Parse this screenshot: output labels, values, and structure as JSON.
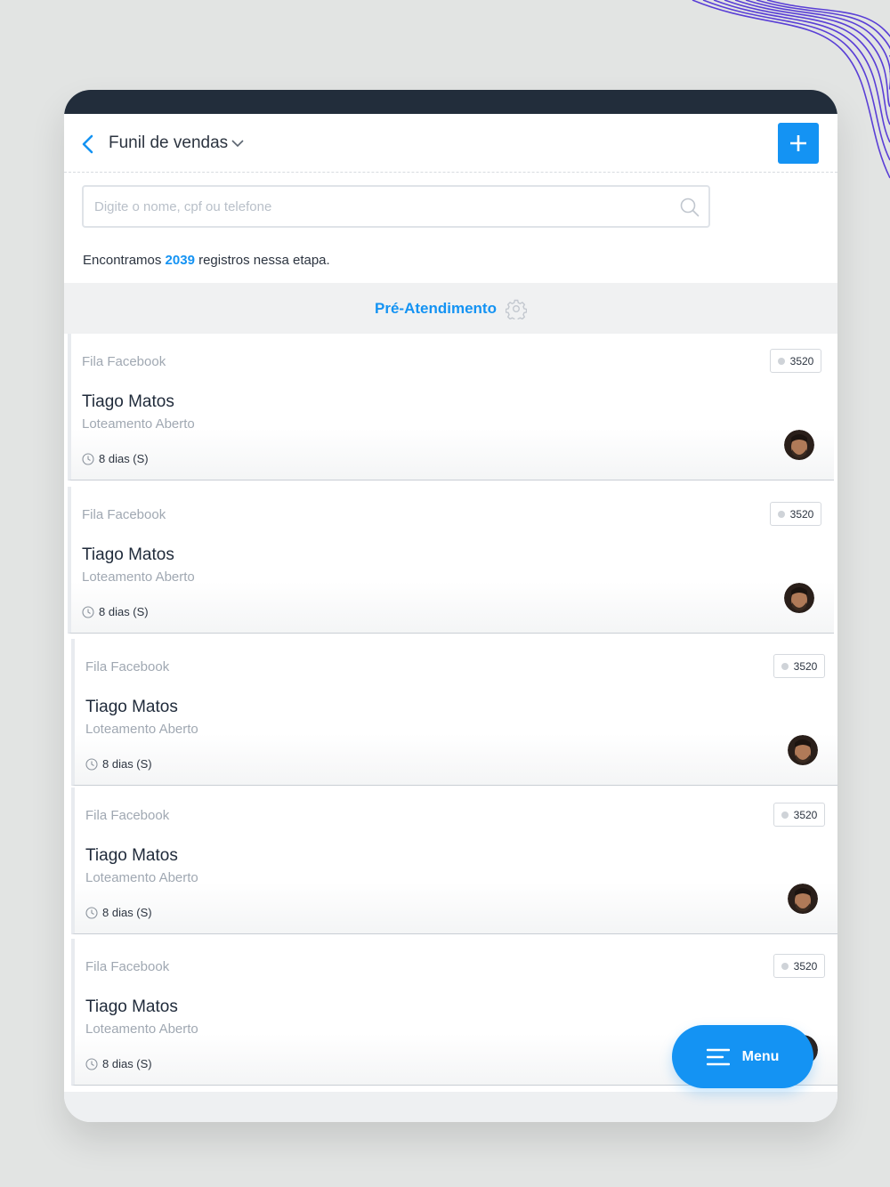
{
  "header": {
    "title": "Funil de vendas"
  },
  "search": {
    "placeholder": "Digite o nome, cpf ou telefone"
  },
  "results": {
    "prefix": "Encontramos",
    "count": "2039",
    "suffix": "registros nessa etapa."
  },
  "stage": {
    "title": "Pré-Atendimento"
  },
  "cards": [
    {
      "queue": "Fila Facebook",
      "id": "3520",
      "name": "Tiago Matos",
      "project": "Loteamento Aberto",
      "time": "8 dias (S)"
    },
    {
      "queue": "Fila Facebook",
      "id": "3520",
      "name": "Tiago Matos",
      "project": "Loteamento Aberto",
      "time": "8 dias (S)"
    },
    {
      "queue": "Fila Facebook",
      "id": "3520",
      "name": "Tiago Matos",
      "project": "Loteamento Aberto",
      "time": "8 dias (S)"
    },
    {
      "queue": "Fila Facebook",
      "id": "3520",
      "name": "Tiago Matos",
      "project": "Loteamento Aberto",
      "time": "8 dias (S)"
    },
    {
      "queue": "Fila Facebook",
      "id": "3520",
      "name": "Tiago Matos",
      "project": "Loteamento Aberto",
      "time": "8 dias (S)"
    }
  ],
  "menu": {
    "label": "Menu"
  },
  "colors": {
    "accent": "#1493f3",
    "statusbar": "#222d3b",
    "background": "#e2e4e3",
    "waves": "#5a3fd6"
  },
  "icons": {
    "back": "chevron-left-icon",
    "dropdown": "chevron-down-icon",
    "add": "plus-icon",
    "search": "search-icon",
    "stage_settings": "gear-icon",
    "time": "clock-icon",
    "menu": "hamburger-icon"
  }
}
